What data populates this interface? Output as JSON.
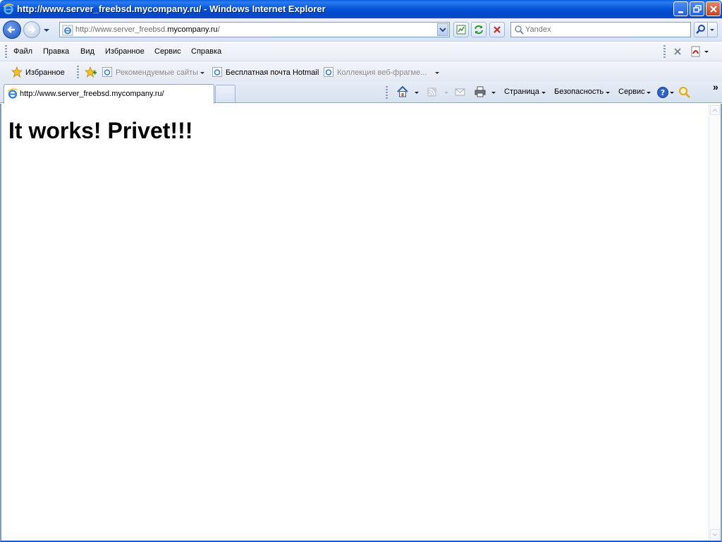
{
  "window": {
    "title": "http://www.server_freebsd.mycompany.ru/ - Windows Internet Explorer"
  },
  "navigation": {
    "address_prefix": "http://www.server_freebsd.",
    "address_domain": "mycompany.ru",
    "address_suffix": "/",
    "search_placeholder": "Yandex"
  },
  "menu": {
    "items": [
      "Файл",
      "Правка",
      "Вид",
      "Избранное",
      "Сервис",
      "Справка"
    ]
  },
  "favorites": {
    "favorites_label": "Избранное",
    "links": [
      "Рекомендуемые сайты",
      "Бесплатная почта Hotmail",
      "Коллекция веб-фрагме..."
    ]
  },
  "tabs": {
    "active_label": "http://www.server_freebsd.mycompany.ru/"
  },
  "command_bar": {
    "page_label": "Страница",
    "safety_label": "Безопасность",
    "tools_label": "Сервис",
    "overflow": "»"
  },
  "content": {
    "heading": "It works! Privet!!!"
  },
  "colors": {
    "titlebar": "#0756d9",
    "chrome": "#dce6f4",
    "heading": "#000000"
  },
  "icons": {
    "app": "ie-logo-icon",
    "back": "back-arrow-icon",
    "forward": "forward-arrow-icon",
    "refresh": "refresh-icon",
    "stop": "stop-icon",
    "search": "magnifier-icon",
    "home": "home-icon",
    "feeds": "rss-icon",
    "mail": "mail-icon",
    "print": "printer-icon",
    "help": "help-icon",
    "research": "research-icon"
  }
}
